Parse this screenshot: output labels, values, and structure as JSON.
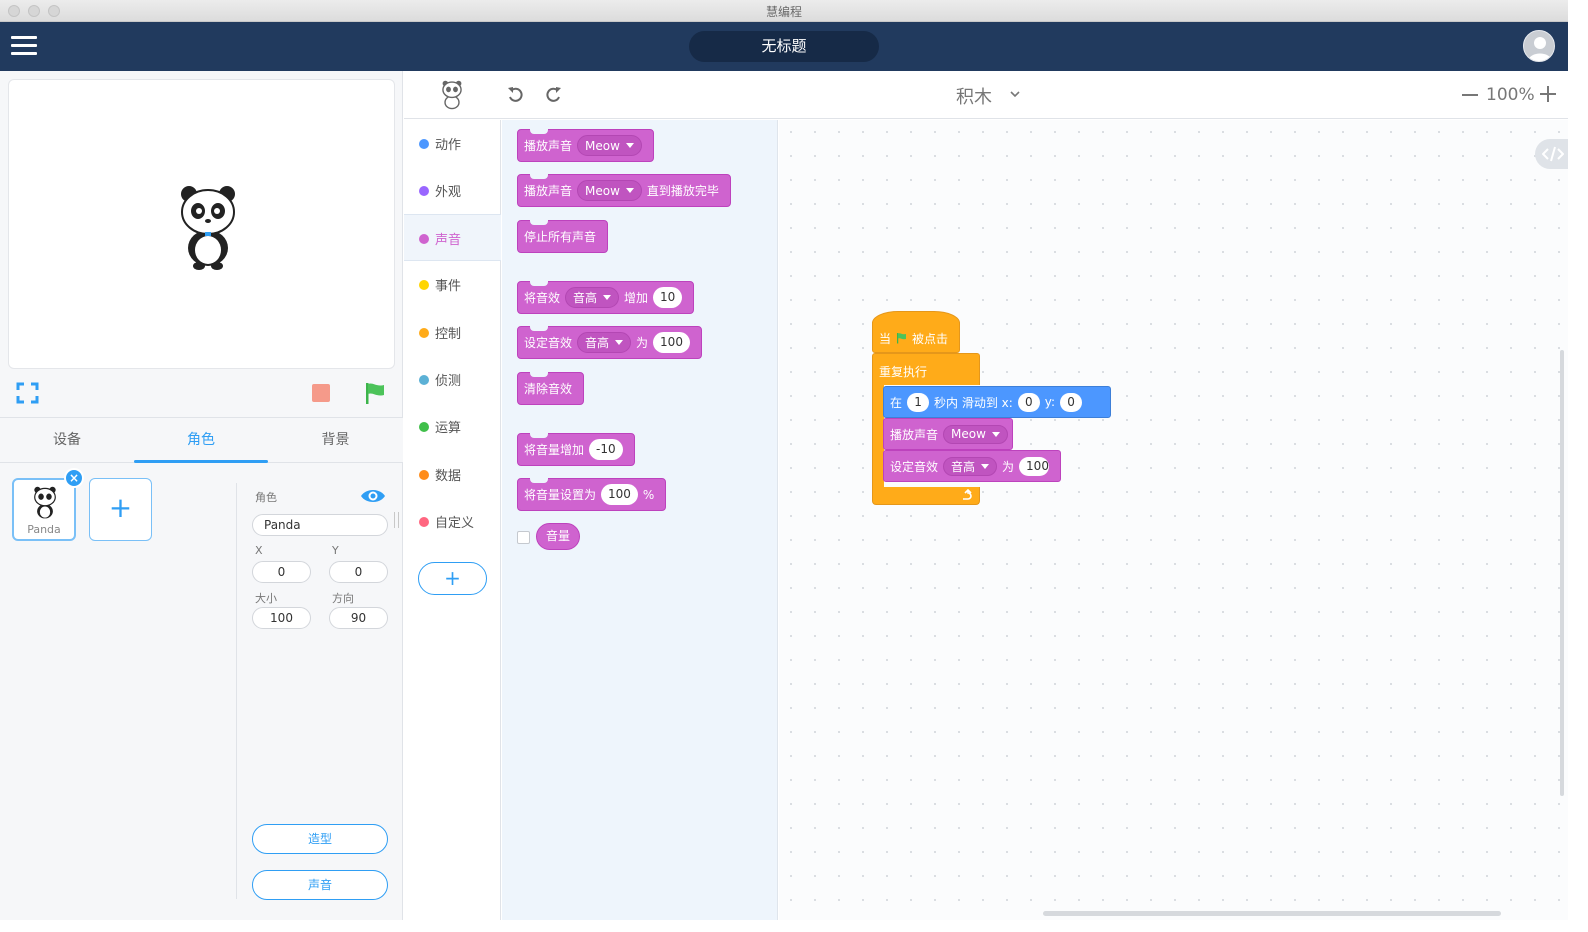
{
  "window": {
    "title": "慧编程"
  },
  "header": {
    "project_title": "无标题"
  },
  "stage_tabs": [
    {
      "label": "设备",
      "active": false
    },
    {
      "label": "角色",
      "active": true
    },
    {
      "label": "背景",
      "active": false
    }
  ],
  "sprite": {
    "name": "Panda",
    "props": {
      "role_label": "角色",
      "name_value": "Panda",
      "x_label": "X",
      "x_value": "0",
      "y_label": "Y",
      "y_value": "0",
      "size_label": "大小",
      "size_value": "100",
      "direction_label": "方向",
      "direction_value": "90"
    },
    "costume_button": "造型",
    "sound_button": "声音"
  },
  "toolbar": {
    "mode_label": "积木",
    "zoom_label": "100%"
  },
  "categories": [
    {
      "label": "动作",
      "color": "#4c97ff"
    },
    {
      "label": "外观",
      "color": "#9966ff"
    },
    {
      "label": "声音",
      "color": "#cf63cf",
      "active": true
    },
    {
      "label": "事件",
      "color": "#ffd500"
    },
    {
      "label": "控制",
      "color": "#ffab19"
    },
    {
      "label": "侦测",
      "color": "#5cb1d6"
    },
    {
      "label": "运算",
      "color": "#40bf4a"
    },
    {
      "label": "数据",
      "color": "#ff8c1a"
    },
    {
      "label": "自定义",
      "color": "#ff6680"
    }
  ],
  "palette": {
    "play_sound": {
      "text": "播放声音",
      "sound": "Meow"
    },
    "play_until_done": {
      "text": "播放声音",
      "sound": "Meow",
      "suffix": "直到播放完毕"
    },
    "stop_all": {
      "text": "停止所有声音"
    },
    "change_effect": {
      "text": "将音效",
      "effect": "音高",
      "mid": "增加",
      "value": "10"
    },
    "set_effect": {
      "text": "设定音效",
      "effect": "音高",
      "mid": "为",
      "value": "100"
    },
    "clear_effects": {
      "text": "清除音效"
    },
    "change_volume": {
      "text": "将音量增加",
      "value": "-10"
    },
    "set_volume": {
      "text": "将音量设置为",
      "value": "100",
      "suffix": "%"
    },
    "volume_reporter": {
      "text": "音量"
    }
  },
  "script": {
    "hat": {
      "before": "当",
      "after": "被点击"
    },
    "repeat": {
      "text": "重复执行"
    },
    "glide": {
      "t1": "在",
      "secs": "1",
      "t2": "秒内 滑动到 x:",
      "x": "0",
      "t3": "y:",
      "y": "0"
    },
    "play_sound": {
      "text": "播放声音",
      "sound": "Meow"
    },
    "set_effect": {
      "text": "设定音效",
      "effect": "音高",
      "mid": "为",
      "value": "100"
    }
  },
  "colors": {
    "header": "#213a5e",
    "accent": "#2f9ef4",
    "sound": "#cf63cf",
    "control": "#ffab19",
    "motion": "#4c97ff"
  }
}
